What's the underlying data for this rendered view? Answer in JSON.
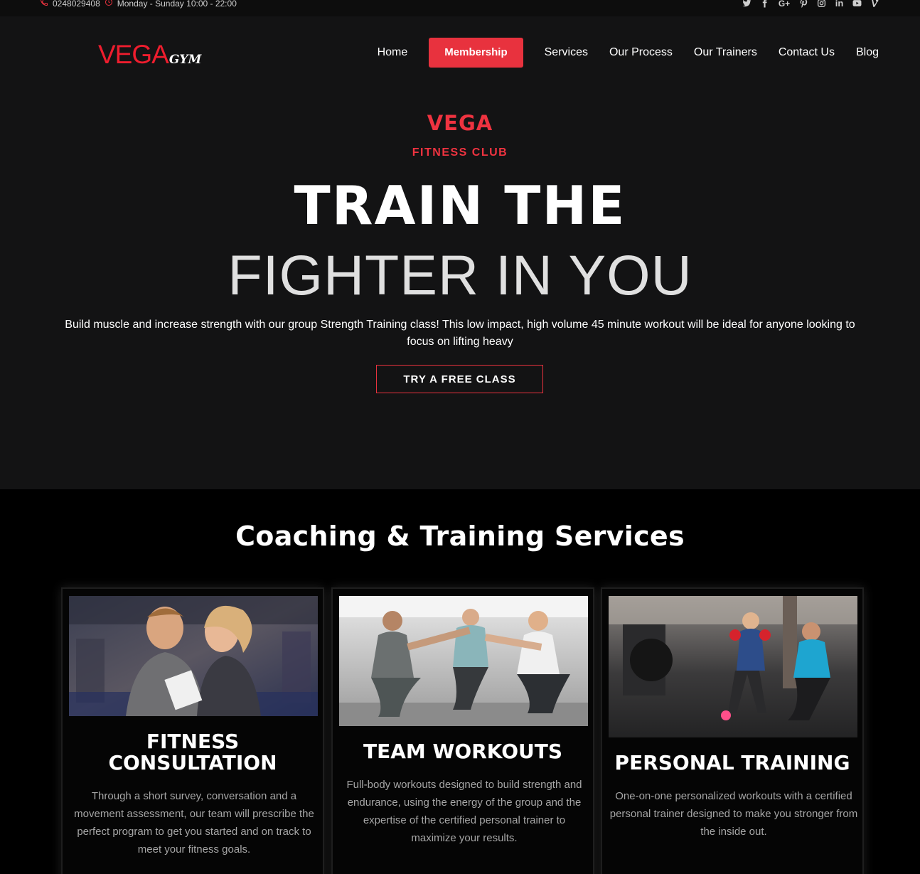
{
  "topbar": {
    "phone": "0248029408",
    "hours": "Monday - Sunday 10:00 - 22:00",
    "social_icons": [
      "twitter-icon",
      "facebook-icon",
      "google-plus-icon",
      "pinterest-icon",
      "instagram-icon",
      "linkedin-icon",
      "youtube-icon",
      "vine-icon"
    ]
  },
  "logo": {
    "primary": "VEGA",
    "secondary": "GYM"
  },
  "nav": {
    "items": [
      {
        "label": "Home"
      },
      {
        "label": "Membership",
        "active": true
      },
      {
        "label": "Services"
      },
      {
        "label": "Our Process"
      },
      {
        "label": "Our Trainers"
      },
      {
        "label": "Contact Us"
      },
      {
        "label": "Blog"
      }
    ]
  },
  "hero": {
    "kicker": "VEGA",
    "subkicker": "FITNESS CLUB",
    "headline_1": "TRAIN THE",
    "headline_2": "FIGHTER IN YOU",
    "lead": "Build muscle and increase strength with our group Strength Training class! This low impact, high volume 45 minute workout will be ideal for anyone looking to focus on lifting heavy",
    "cta": "TRY A FREE CLASS"
  },
  "services": {
    "heading": "Coaching & Training Services",
    "cards": [
      {
        "title": "FITNESS CONSULTATION",
        "description": "Through a short survey, conversation and a movement assessment, our team will prescribe the perfect program to get you started and on track to meet your fitness goals."
      },
      {
        "title": "TEAM WORKOUTS",
        "description": "Full-body workouts designed to build strength and endurance, using the energy of the group and the expertise of the certified personal trainer to maximize your results."
      },
      {
        "title": "PERSONAL TRAINING",
        "description": "One-on-one personalized workouts with a certified personal trainer designed to make you stronger from the inside out."
      }
    ]
  },
  "colors": {
    "accent": "#e8323e",
    "hero_bg": "#131314",
    "services_bg": "#000000",
    "muted_text": "#a6a6a6"
  }
}
